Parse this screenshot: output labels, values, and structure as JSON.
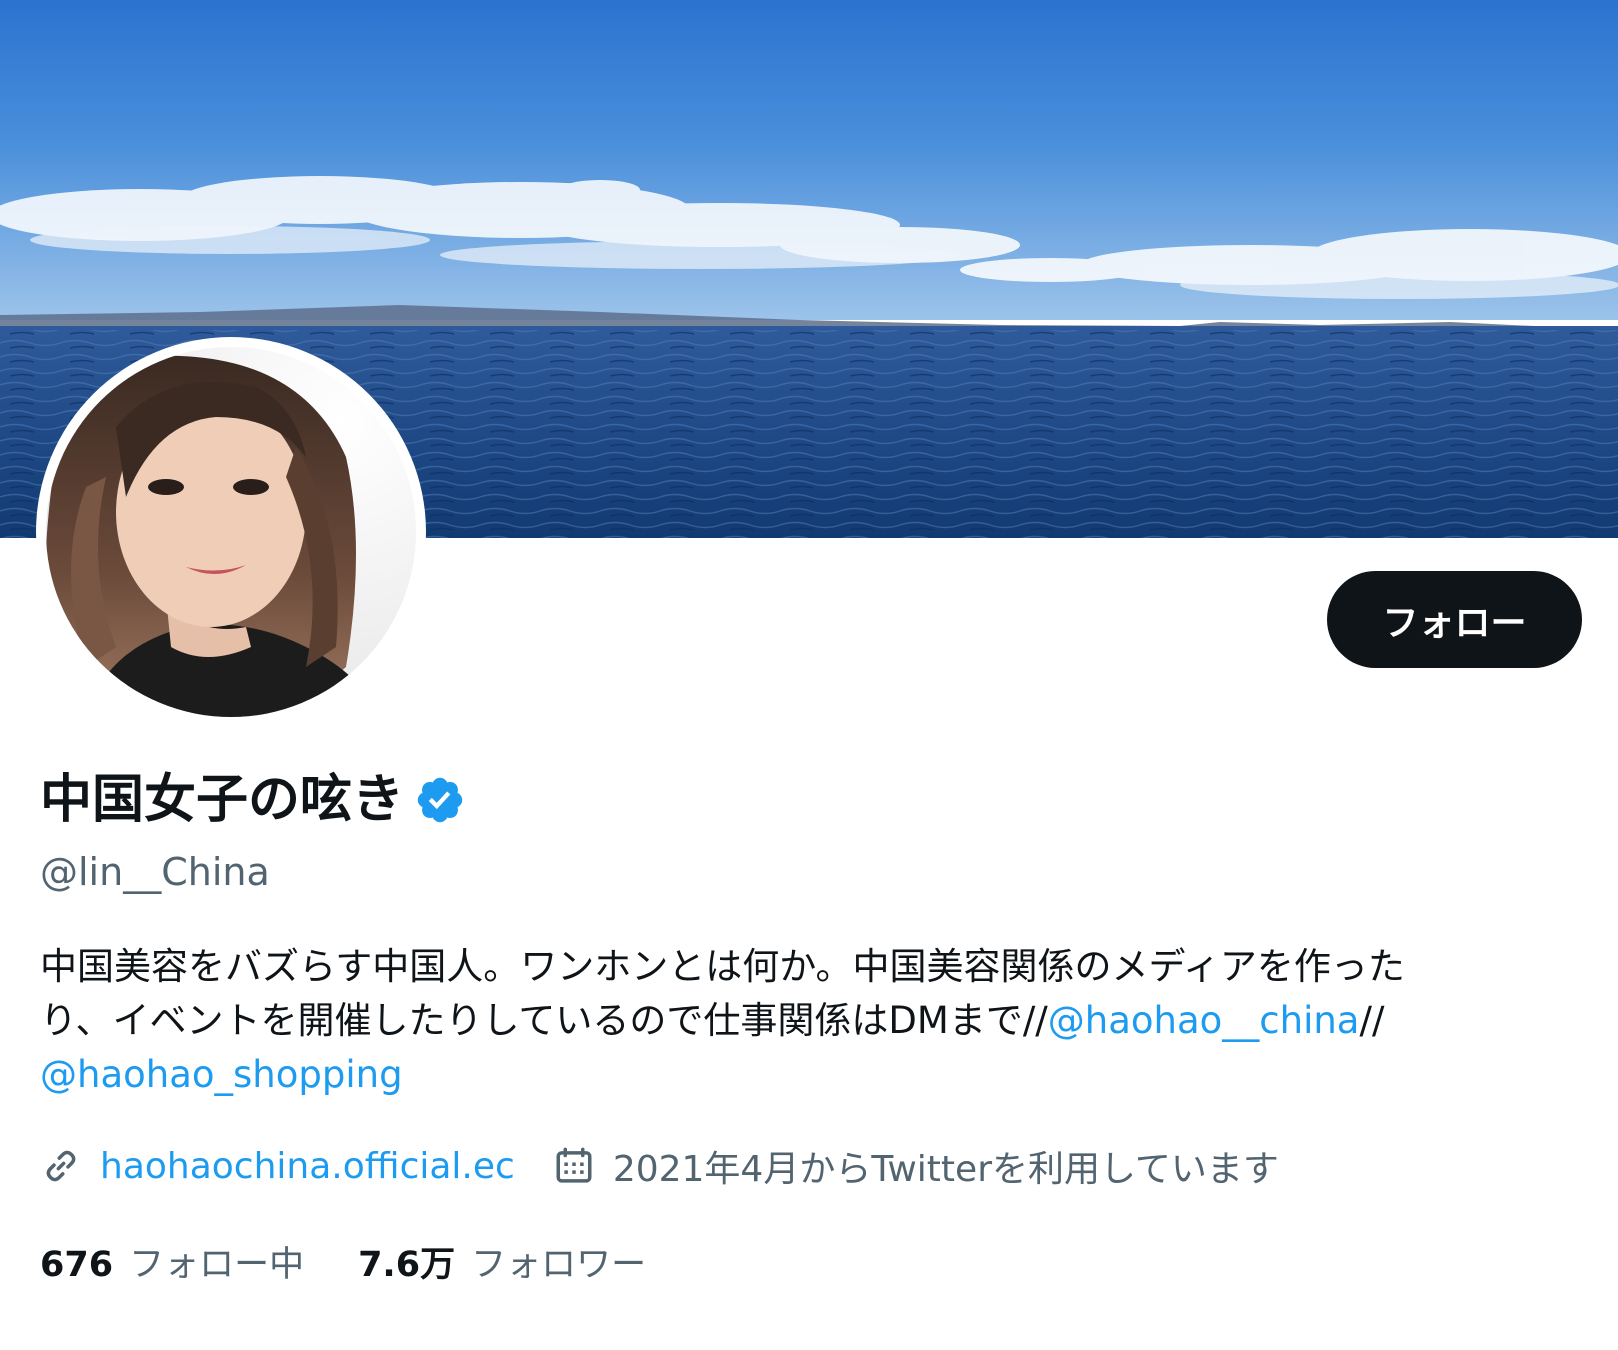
{
  "profile": {
    "display_name": "中国女子の呟き",
    "handle": "@lin__China",
    "follow_label": "フォロー",
    "bio": {
      "text_line1": "中国美容をバズらす中国人。ワンホンとは何か。中国美容関係のメディアを作った",
      "text_line2": "り、イベントを開催したりしているので仕事関係はDMまで//",
      "mention1": "@haohao__china",
      "separator": "//",
      "mention2": "@haohao_shopping"
    },
    "website": "haohaochina.official.ec",
    "joined": "2021年4月からTwitterを利用しています",
    "stats": {
      "following_count": "676",
      "following_label": "フォロー中",
      "followers_count": "7.6万",
      "followers_label": "フォロワー"
    }
  },
  "icons": {
    "verified": "verified-badge-icon",
    "link": "link-icon",
    "calendar": "calendar-icon"
  },
  "colors": {
    "accent": "#1d9bf0",
    "button_bg": "#0f1419",
    "secondary_text": "#536471"
  }
}
